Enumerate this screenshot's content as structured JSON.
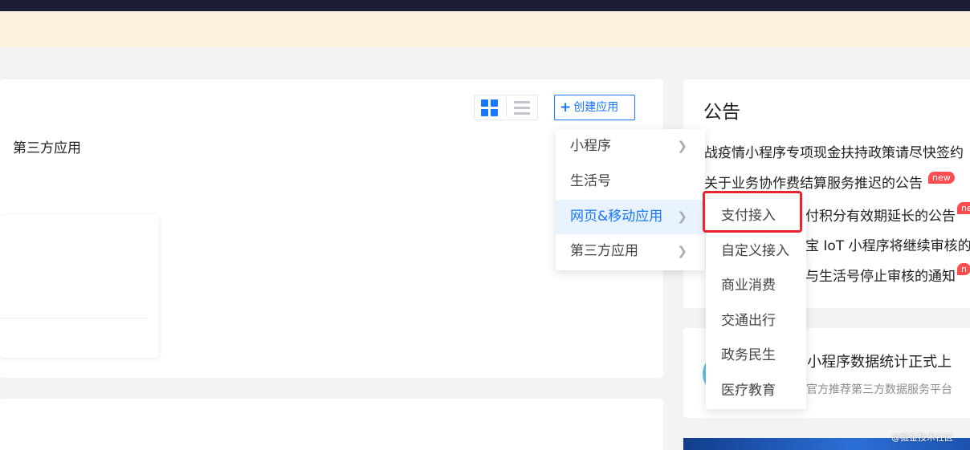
{
  "colors": {
    "topbar": "#1c1e36",
    "notice_strip": "#fdf2dd",
    "accent": "#1677ff",
    "new_badge": "#ff4d4f",
    "highlight": "#e8252d"
  },
  "toolbar": {
    "grid_view_icon": "grid-view-icon",
    "list_view_icon": "list-view-icon",
    "create_icon": "plus-icon",
    "create_label": "创建应用"
  },
  "main": {
    "tab_label": "第三方应用"
  },
  "create_menu": {
    "items": [
      {
        "label": "小程序",
        "has_submenu": true
      },
      {
        "label": "生活号",
        "has_submenu": false
      },
      {
        "label": "网页&移动应用",
        "has_submenu": true,
        "active": true
      },
      {
        "label": "第三方应用",
        "has_submenu": true
      }
    ],
    "arrow_icon": "chevron-right-icon"
  },
  "submenu": {
    "items": [
      "支付接入",
      "自定义接入",
      "商业消费",
      "交通出行",
      "政务民生",
      "医疗教育"
    ],
    "highlighted": "支付接入"
  },
  "announcements": {
    "title": "公告",
    "items": [
      {
        "text": "战疫情小程序专项现金扶持政策请尽快签约",
        "badge": ""
      },
      {
        "text": "关于业务协作费结算服务推迟的公告",
        "badge": "new"
      },
      {
        "text": "付积分有效期延长的公告",
        "badge": "ne"
      },
      {
        "text": "宝 IoT 小程序将继续审核的",
        "badge": ""
      },
      {
        "text": "与生活号停止审核的通知",
        "badge": "n"
      }
    ]
  },
  "promo": {
    "title": "+小程序数据统计正式上",
    "subtitle": "官方推荐第三方数据服务平台"
  },
  "watermark": "@掘金技术社区"
}
